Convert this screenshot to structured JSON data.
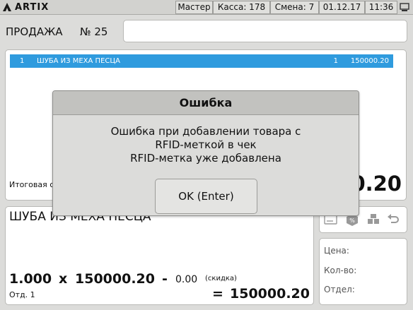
{
  "app": {
    "logo_text": "ARTIX"
  },
  "statusbar": {
    "user": "Мастер",
    "register": "Касса: 178",
    "shift": "Смена: 7",
    "date": "01.12.17",
    "time": "11:36",
    "monitor_icon": "monitor-icon"
  },
  "header": {
    "title": "ПРОДАЖА",
    "number": "№ 25",
    "input_value": ""
  },
  "receipt": {
    "rows": [
      {
        "index": "1",
        "name": "ШУБА ИЗ МЕХА ПЕСЦА",
        "qty": "1",
        "sum": "150000.20",
        "selected_color": "#2f9bde"
      }
    ],
    "total_label": "Итоговая с",
    "total_value": "150000.20"
  },
  "item": {
    "name": "ШУБА ИЗ МЕХА ПЕСЦА",
    "quantity": "1.000",
    "times": "x",
    "price": "150000.20",
    "minus": "-",
    "discount": "0.00",
    "discount_label": "(скидка)",
    "department": "Отд. 1",
    "equals": "=",
    "sum": "150000.20"
  },
  "tools": {
    "icons": [
      "card-icon",
      "discount-box-icon",
      "boxes-icon",
      "return-icon"
    ]
  },
  "info": {
    "price_label": "Цена:",
    "qty_label": "Кол-во:",
    "dept_label": "Отдел:"
  },
  "dialog": {
    "title": "Ошибка",
    "message_line1": "Ошибка при добавлении товара с",
    "message_line2": "RFID-меткой в чек",
    "message_line3": "RFID-метка уже добавлена",
    "ok_label": "OK (Enter)"
  },
  "colors": {
    "accent": "#2f9bde",
    "background": "#dcdcda"
  }
}
